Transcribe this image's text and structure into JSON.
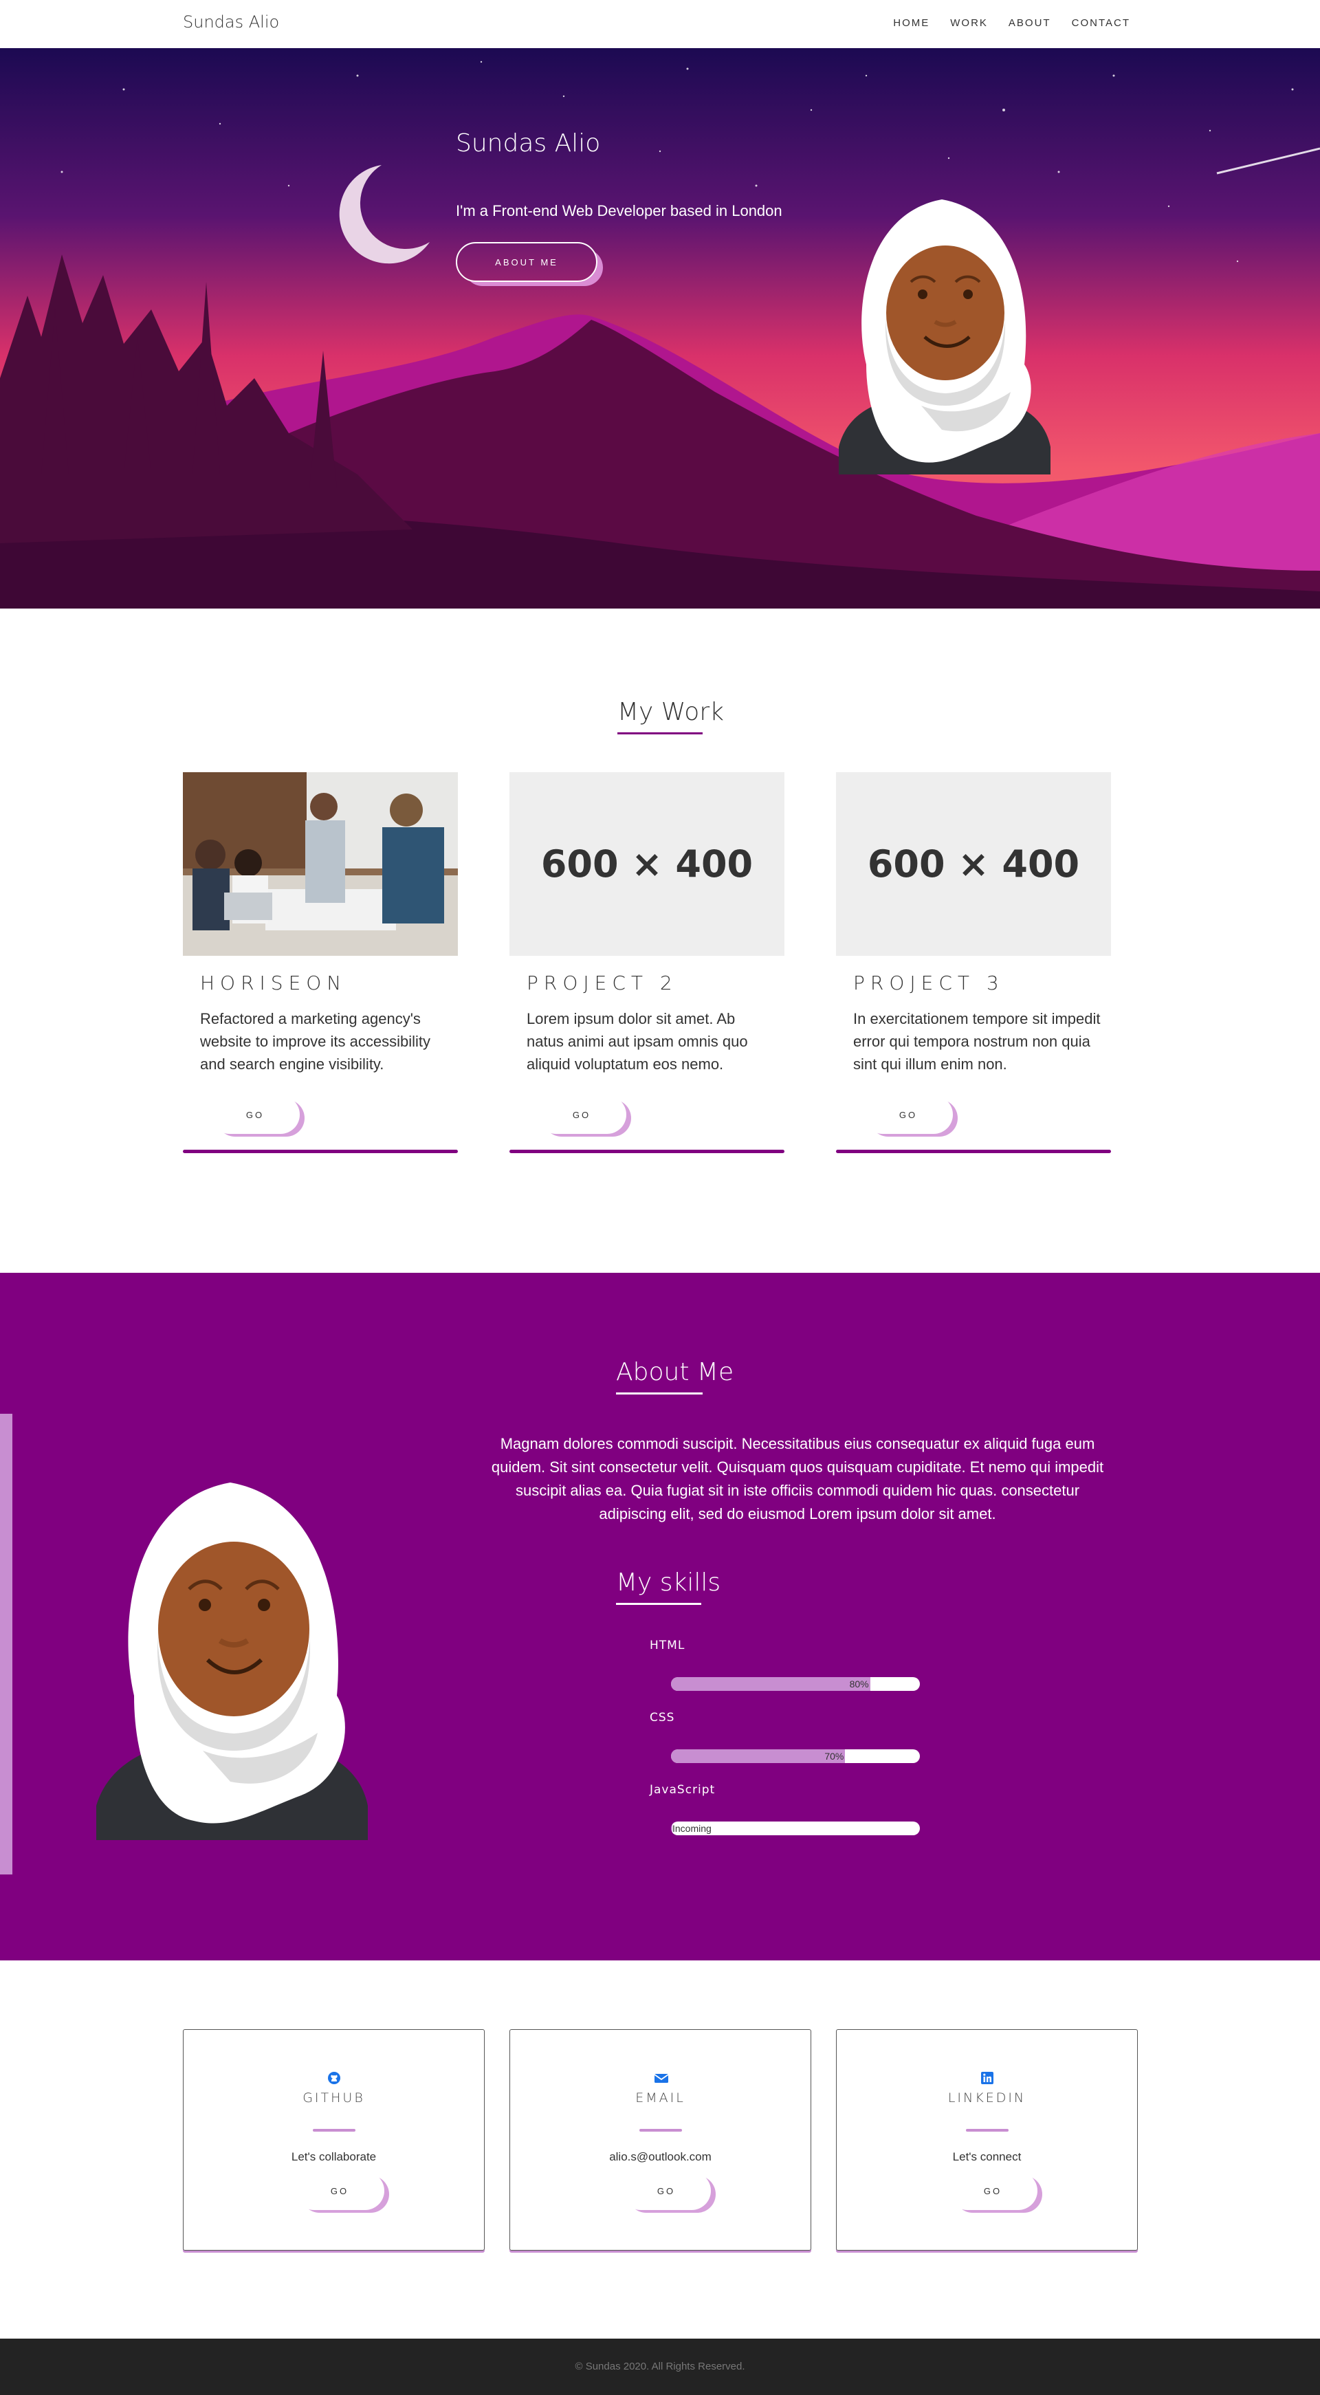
{
  "nav": {
    "brand": "Sundas Alio",
    "links": [
      "HOME",
      "WORK",
      "ABOUT",
      "CONTACT"
    ]
  },
  "hero": {
    "title": "Sundas Alio",
    "subtitle": "I'm a Front-end Web Developer based in London",
    "button": "ABOUT ME"
  },
  "work": {
    "heading": "My Work",
    "cards": [
      {
        "placeholder": "",
        "title": "HORISEON",
        "text": "Refactored a marketing agency's website to improve its accessibility and search engine visibility.",
        "button": "GO"
      },
      {
        "placeholder": "600 × 400",
        "title": "PROJECT 2",
        "text": "Lorem ipsum dolor sit amet. Ab natus animi aut ipsam omnis quo aliquid voluptatum eos nemo.",
        "button": "GO"
      },
      {
        "placeholder": "600 × 400",
        "title": "PROJECT 3",
        "text": "In exercitationem tempore sit impedit error qui tempora nostrum non quia sint qui illum enim non.",
        "button": "GO"
      }
    ]
  },
  "about": {
    "heading": "About Me",
    "text": "Magnam dolores commodi suscipit. Necessitatibus eius consequatur ex aliquid fuga eum quidem. Sit sint consectetur velit. Quisquam quos quisquam cupiditate. Et nemo qui impedit suscipit alias ea. Quia fugiat sit in iste officiis commodi quidem hic quas. consectetur adipiscing elit, sed do eiusmod Lorem ipsum dolor sit amet.",
    "skills_heading": "My skills",
    "skills": [
      {
        "name": "HTML",
        "label": "80%",
        "level": 0.8
      },
      {
        "name": "CSS",
        "label": "70%",
        "level": 0.7
      },
      {
        "name": "JavaScript",
        "label": "Incoming",
        "level": 0
      }
    ]
  },
  "contact": {
    "cards": [
      {
        "icon": "github-icon",
        "title": "GITHUB",
        "desc": "Let's collaborate",
        "button": "GO"
      },
      {
        "icon": "envelope-icon",
        "title": "EMAIL",
        "desc": "alio.s@outlook.com",
        "button": "GO"
      },
      {
        "icon": "linkedin-icon",
        "title": "LINKEDIN",
        "desc": "Let's connect",
        "button": "GO"
      }
    ]
  },
  "footer": {
    "text": "© Sundas 2020. All Rights Reserved."
  },
  "colors": {
    "accent": "#800080",
    "accent_light": "#c88ed1",
    "icon_blue": "#1a73e8",
    "footer_bg": "#232323"
  }
}
